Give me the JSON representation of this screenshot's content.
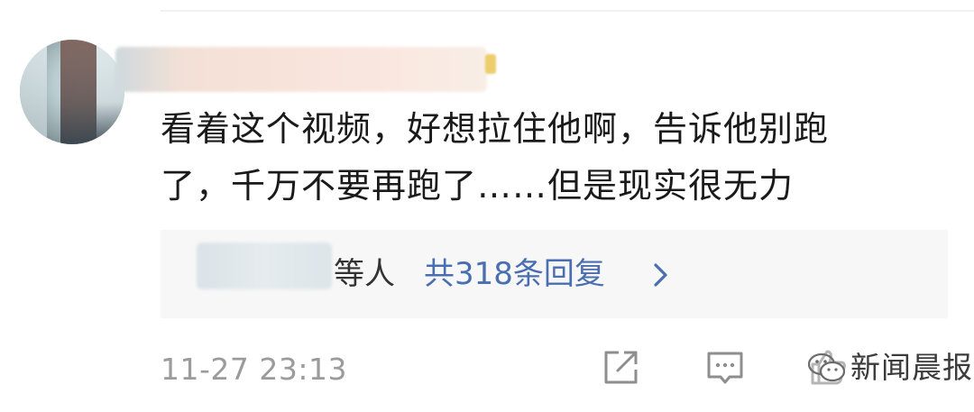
{
  "comment": {
    "text_line1": "看着这个视频，好想拉住他啊，告诉他别跑",
    "text_line2": "了，千万不要再跑了……但是现实很无力",
    "timestamp": "11-27 23:13"
  },
  "replies": {
    "suffix": "等人",
    "link_label": "共318条回复"
  },
  "actions": {
    "share_icon": "share-icon",
    "comment_icon": "comment-icon",
    "like_icon": "thumbs-up-icon"
  },
  "watermark": {
    "text": "新闻晨报"
  },
  "colors": {
    "text_primary": "#1a1a1a",
    "link_blue": "#4a6fb0",
    "muted": "#9b9b9b",
    "reply_bg": "#f7f7f7"
  }
}
